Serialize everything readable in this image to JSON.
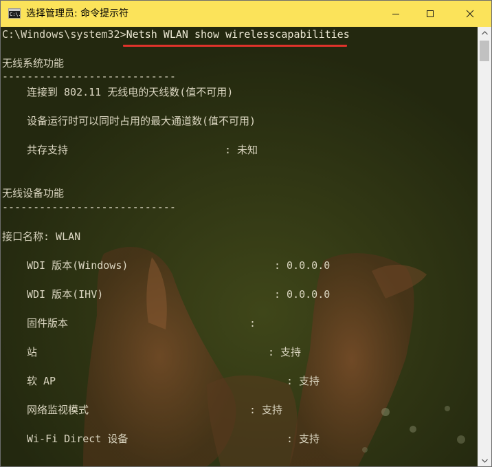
{
  "window": {
    "title": "选择管理员: 命令提示符",
    "icon_label": "C:\\.",
    "accent_color": "#fbe35a"
  },
  "console": {
    "prompt": "C:\\Windows\\system32>",
    "command": "Netsh WLAN show wirelesscapabilities",
    "highlight_color": "#e0332b",
    "section1": {
      "title": "无线系统功能",
      "rule": "----------------------------",
      "antennas": "连接到 802.11 无线电的天线数(值不可用)",
      "channels": "设备运行时可以同时占用的最大通道数(值不可用)",
      "coexist_label": "共存支持",
      "coexist_value": ": 未知"
    },
    "section2": {
      "title": "无线设备功能",
      "rule": "----------------------------",
      "interface": "接口名称: WLAN",
      "rows": [
        {
          "label": "WDI 版本(Windows)",
          "value": ": 0.0.0.0"
        },
        {
          "label": "WDI 版本(IHV)",
          "value": ": 0.0.0.0"
        },
        {
          "label": "固件版本",
          "value": ":"
        },
        {
          "label": "站",
          "value": ": 支持"
        },
        {
          "label": "软 AP",
          "value": ": 支持"
        },
        {
          "label": "网络监视模式",
          "value": ": 支持"
        },
        {
          "label": "Wi-Fi Direct 设备",
          "value": ": 支持"
        }
      ]
    }
  }
}
